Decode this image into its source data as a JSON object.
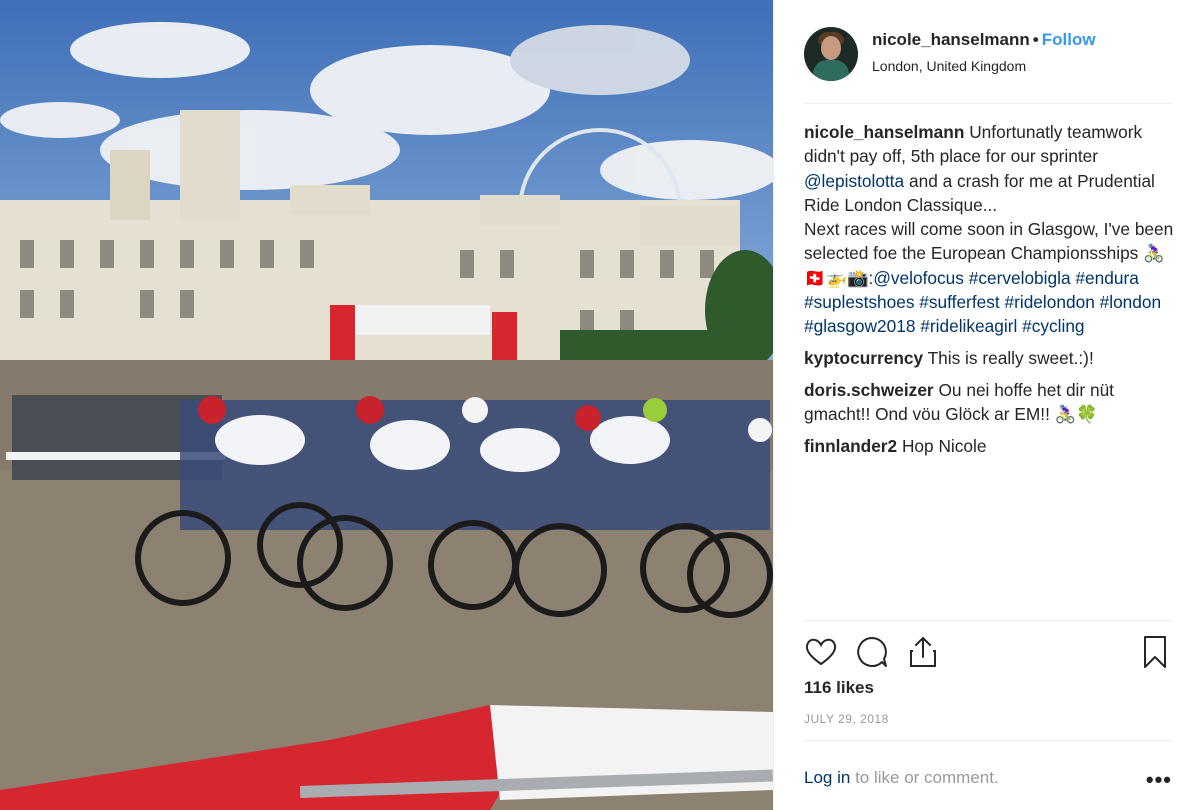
{
  "post": {
    "username": "nicole_hanselmann",
    "follow_label": "Follow",
    "separator": "•",
    "location": "London, United Kingdom",
    "caption": {
      "username": "nicole_hanselmann",
      "text_1": "Unfortunatly teamwork didn't pay off, 5th place for our sprinter",
      "mention_1": "@lepistolotta",
      "text_2": "and a crash for me at Prudential Ride London Classique...",
      "text_3": "Next races will come soon in Glasgow, I've been selected foe the European Championsships 🚴🏼‍♀️🇨🇭🚁📸:",
      "mention_2": "@velofocus",
      "hashtags": [
        "#cervelobigla",
        "#endura",
        "#suplestshoes",
        "#sufferfest",
        "#ridelondon",
        "#london",
        "#glasgow2018",
        "#ridelikeagirl",
        "#cycling"
      ]
    },
    "comments": [
      {
        "user": "kyptocurrency",
        "text": "This is really sweet.:)!"
      },
      {
        "user": "doris.schweizer",
        "text": "Ou nei hoffe het dir nüt gmacht!! Ond vöu Glöck ar EM!! 🚴🏼‍♀️🍀"
      },
      {
        "user": "finnlander2",
        "text": "Hop Nicole"
      }
    ],
    "likes": "116 likes",
    "date": "JULY 29, 2018",
    "login_link": "Log in",
    "login_rest": "to like or comment.",
    "more": "•••"
  },
  "icons": {
    "like": "heart-icon",
    "comment": "speech-bubble-icon",
    "share": "share-upload-icon",
    "save": "bookmark-icon",
    "more": "ellipsis-icon"
  },
  "colors": {
    "accent": "#3897f0",
    "link": "#003569",
    "text": "#262626",
    "muted": "#999999"
  }
}
